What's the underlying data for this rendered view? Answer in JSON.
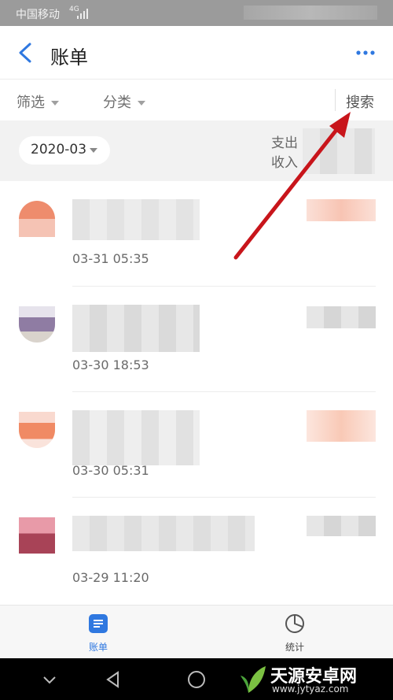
{
  "status_bar": {
    "carrier": "中国移动",
    "signal": "4G"
  },
  "header": {
    "title": "账单"
  },
  "filters": {
    "filter_label": "筛选",
    "category_label": "分类",
    "search_label": "搜索"
  },
  "month_bar": {
    "month": "2020-03",
    "expense_label": "支出",
    "income_label": "收入"
  },
  "transactions": [
    {
      "time": "03-31  05:35",
      "avatar_color": "#ef8d6f"
    },
    {
      "time": "03-30  18:53",
      "avatar_color": "#8f7ca3"
    },
    {
      "time": "03-30  05:31",
      "avatar_color": "#f08a64"
    },
    {
      "time": "03-29  11:20",
      "avatar_color": "#c85b6e"
    }
  ],
  "tabs": [
    {
      "label": "账单",
      "active": true
    },
    {
      "label": "统计",
      "active": false
    }
  ],
  "watermark": {
    "brand": "天源安卓网",
    "url": "www.jytyaz.com"
  },
  "colors": {
    "accent": "#2f78e0",
    "arrow": "#c8151b"
  }
}
